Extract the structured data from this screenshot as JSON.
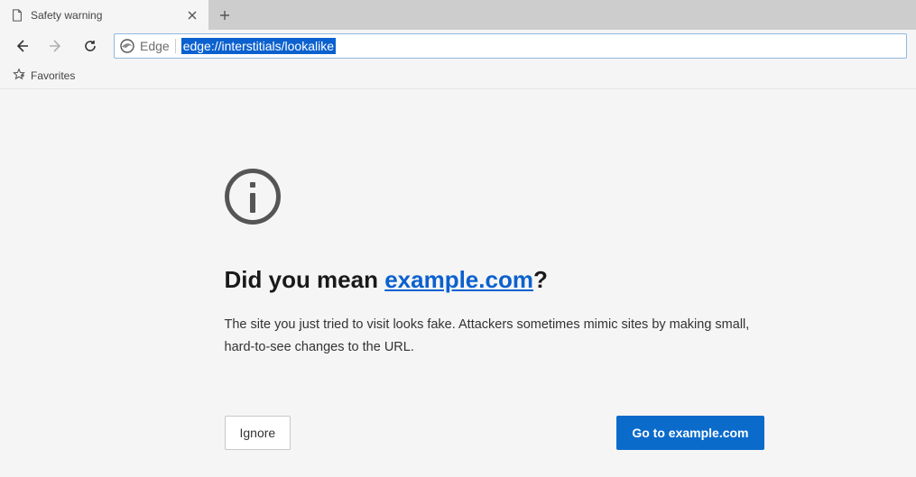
{
  "tab": {
    "title": "Safety warning"
  },
  "address": {
    "prefix_label": "Edge",
    "url": "edge://interstitials/lookalike"
  },
  "favorites": {
    "label": "Favorites"
  },
  "interstitial": {
    "heading_pre": "Did you mean ",
    "heading_link": "example.com",
    "heading_post": "?",
    "body": "The site you just tried to visit looks fake. Attackers sometimes mimic sites by making small, hard-to-see changes to the URL.",
    "ignore_label": "Ignore",
    "go_label": "Go to example.com"
  }
}
